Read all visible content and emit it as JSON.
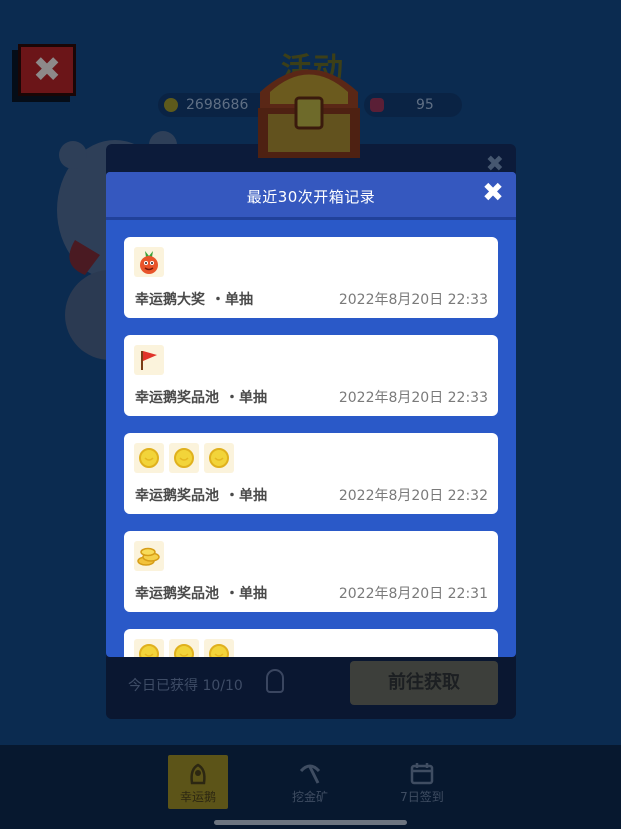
{
  "background": {
    "title": "活动",
    "coins": "2698686",
    "tickets": "95",
    "bottom": {
      "today_label": "今日已获得",
      "today_value": "10/10",
      "go_button": "前往获取"
    },
    "nav": [
      {
        "label": "幸运鹅",
        "icon": "goose-icon",
        "active": true
      },
      {
        "label": "挖金矿",
        "icon": "pickaxe-icon",
        "active": false
      },
      {
        "label": "7日签到",
        "icon": "calendar-icon",
        "active": false
      }
    ]
  },
  "modal": {
    "title": "最近30次开箱记录",
    "records": [
      {
        "icons": [
          "monster-icon"
        ],
        "name": "幸运鹅大奖",
        "draw": "・单抽",
        "time": "2022年8月20日 22:33"
      },
      {
        "icons": [
          "flag-icon"
        ],
        "name": "幸运鹅奖品池",
        "draw": "・单抽",
        "time": "2022年8月20日 22:33"
      },
      {
        "icons": [
          "coin-icon",
          "coin-icon",
          "coin-icon"
        ],
        "name": "幸运鹅奖品池",
        "draw": "・单抽",
        "time": "2022年8月20日 22:32"
      },
      {
        "icons": [
          "coin-pile-icon"
        ],
        "name": "幸运鹅奖品池",
        "draw": "・单抽",
        "time": "2022年8月20日 22:31"
      },
      {
        "icons": [
          "coin-icon",
          "coin-icon",
          "coin-icon"
        ],
        "name": "",
        "draw": "",
        "time": ""
      }
    ]
  },
  "colors": {
    "modal_blue": "#2a59c8",
    "header_blue": "#3558bf",
    "card_bg": "#ffffff",
    "coin_gold": "#f2d43a",
    "flag_red": "#e0332a"
  }
}
